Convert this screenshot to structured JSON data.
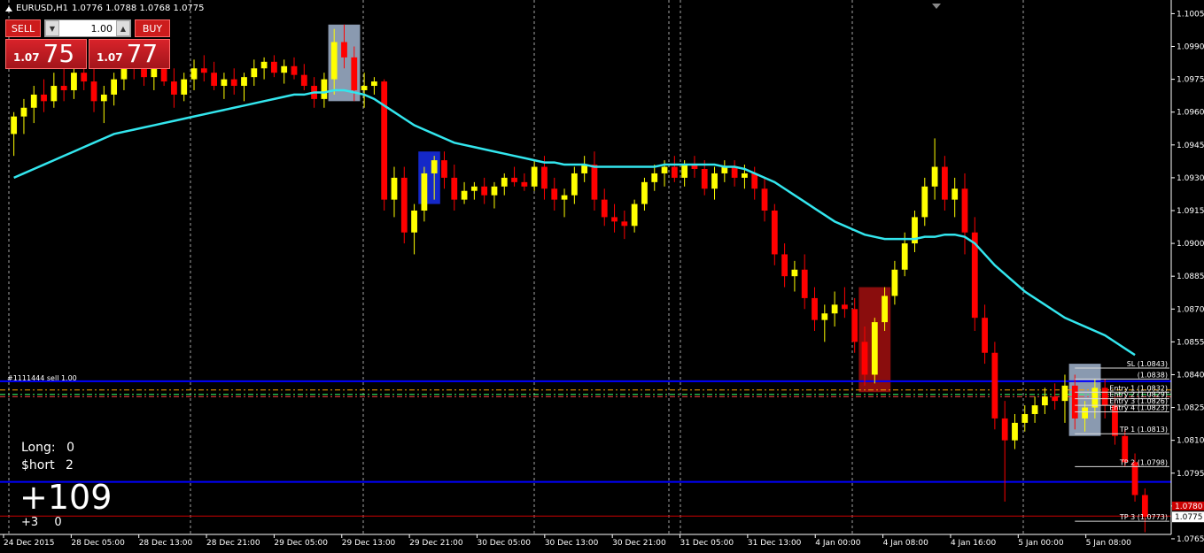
{
  "header": {
    "symbol": "EURUSD,H1",
    "ohlc": "1.0776 1.0788 1.0768 1.0775"
  },
  "trade_panel": {
    "sell_label": "SELL",
    "buy_label": "BUY",
    "lot_value": "1.00",
    "sell_price_prefix": "1.07",
    "sell_price_big": "75",
    "buy_price_prefix": "1.07",
    "buy_price_big": "77"
  },
  "stats": {
    "long_label": "Long:",
    "long_value": "0",
    "short_label": "$hort",
    "short_value": "2",
    "profit": "+109",
    "small_left": "+3",
    "small_right": "0"
  },
  "order_tag": "#1111444 sell 1.00",
  "colors": {
    "bull": "#ffff00",
    "bear": "#ff0000",
    "ma": "#33e6ee",
    "level_blue": "#0000ff",
    "current_price": "#cc0000"
  },
  "chart_data": {
    "type": "candlestick",
    "symbol": "EURUSD",
    "timeframe": "H1",
    "ylim": [
      1.0767,
      1.1008
    ],
    "price_ticks": [
      "1.1005",
      "1.0990",
      "1.0975",
      "1.0960",
      "1.0945",
      "1.0930",
      "1.0915",
      "1.0900",
      "1.0885",
      "1.0870",
      "1.0855",
      "1.0840",
      "1.0825",
      "1.0810",
      "1.0795",
      "1.0780",
      "1.0765"
    ],
    "price_tick_values": [
      1.1005,
      1.099,
      1.0975,
      1.096,
      1.0945,
      1.093,
      1.0915,
      1.09,
      1.0885,
      1.087,
      1.0855,
      1.084,
      1.0825,
      1.081,
      1.0795,
      1.078,
      1.0765
    ],
    "time_labels": [
      "24 Dec 2015",
      "28 Dec 05:00",
      "28 Dec 13:00",
      "28 Dec 21:00",
      "29 Dec 05:00",
      "29 Dec 13:00",
      "29 Dec 21:00",
      "30 Dec 05:00",
      "30 Dec 13:00",
      "30 Dec 21:00",
      "31 Dec 05:00",
      "31 Dec 13:00",
      "4 Jan 00:00",
      "4 Jan 08:00",
      "4 Jan 16:00",
      "5 Jan 00:00",
      "5 Jan 08:00"
    ],
    "current_price": 1.0775,
    "current_price_label": "1.0775",
    "current_price_marker": "1.0780",
    "blue_levels": [
      1.0837,
      1.0791
    ],
    "dashed_levels": [
      1.0833,
      1.0831,
      1.083
    ],
    "trade_levels": [
      {
        "label": "SL (1.0843)",
        "value": 1.0843
      },
      {
        "label": "(1.0838)",
        "value": 1.0838
      },
      {
        "label": "Entry 1 (1.0832)",
        "value": 1.0832
      },
      {
        "label": "Entry 2 (1.0829)",
        "value": 1.0829
      },
      {
        "label": "Entry 3 (1.0826)",
        "value": 1.0826
      },
      {
        "label": "Entry 4 (1.0823)",
        "value": 1.0823
      },
      {
        "label": "TP 1 (1.0813)",
        "value": 1.0813
      },
      {
        "label": "TP 2 (1.0798)",
        "value": 1.0798
      },
      {
        "label": "TP 3 (1.0773)",
        "value": 1.0773
      }
    ],
    "candles": [
      [
        1.095,
        1.096,
        1.094,
        1.0958
      ],
      [
        1.0958,
        1.0966,
        1.095,
        1.0962
      ],
      [
        1.0962,
        1.0972,
        1.0955,
        1.0968
      ],
      [
        1.0968,
        1.0975,
        1.096,
        1.0965
      ],
      [
        1.0965,
        1.0978,
        1.0962,
        1.0972
      ],
      [
        1.0972,
        1.098,
        1.0965,
        1.097
      ],
      [
        1.097,
        1.0982,
        1.0966,
        1.0978
      ],
      [
        1.0978,
        1.0985,
        1.097,
        1.0974
      ],
      [
        1.0974,
        1.098,
        1.096,
        1.0965
      ],
      [
        1.0965,
        1.0972,
        1.0955,
        1.0968
      ],
      [
        1.0968,
        1.0978,
        1.0963,
        1.0975
      ],
      [
        1.0975,
        1.0986,
        1.097,
        1.0982
      ],
      [
        1.0982,
        1.0988,
        1.0975,
        1.098
      ],
      [
        1.098,
        1.0985,
        1.0972,
        1.0976
      ],
      [
        1.0976,
        1.0983,
        1.097,
        1.098
      ],
      [
        1.098,
        1.0986,
        1.0972,
        1.0974
      ],
      [
        1.0974,
        1.098,
        1.0962,
        1.0968
      ],
      [
        1.0968,
        1.0978,
        1.0965,
        1.0975
      ],
      [
        1.0975,
        1.0984,
        1.097,
        1.098
      ],
      [
        1.098,
        1.0986,
        1.0974,
        1.0978
      ],
      [
        1.0978,
        1.0983,
        1.097,
        1.0972
      ],
      [
        1.0972,
        1.0978,
        1.0966,
        1.0975
      ],
      [
        1.0975,
        1.098,
        1.0968,
        1.0972
      ],
      [
        1.0972,
        1.0978,
        1.0965,
        1.0976
      ],
      [
        1.0976,
        1.0984,
        1.0972,
        1.098
      ],
      [
        1.098,
        1.0985,
        1.0975,
        1.0983
      ],
      [
        1.0983,
        1.0986,
        1.0976,
        1.0978
      ],
      [
        1.0978,
        1.0984,
        1.0973,
        1.0981
      ],
      [
        1.0981,
        1.0985,
        1.0975,
        1.0977
      ],
      [
        1.0977,
        1.0982,
        1.097,
        1.0972
      ],
      [
        1.0972,
        1.0976,
        1.0962,
        1.0966
      ],
      [
        1.0966,
        1.0978,
        1.0962,
        1.0975
      ],
      [
        1.0975,
        1.0998,
        1.0968,
        1.0992
      ],
      [
        1.0992,
        1.1,
        1.098,
        1.0985
      ],
      [
        1.0985,
        1.099,
        1.0965,
        1.097
      ],
      [
        1.097,
        1.0978,
        1.0962,
        1.0972
      ],
      [
        1.0972,
        1.0976,
        1.0968,
        1.0974
      ],
      [
        1.0974,
        1.0975,
        1.0915,
        1.092
      ],
      [
        1.092,
        1.0935,
        1.0912,
        1.093
      ],
      [
        1.093,
        1.0935,
        1.09,
        1.0905
      ],
      [
        1.0905,
        1.0918,
        1.0895,
        1.0915
      ],
      [
        1.0915,
        1.0935,
        1.091,
        1.0932
      ],
      [
        1.0932,
        1.094,
        1.092,
        1.0938
      ],
      [
        1.0938,
        1.0942,
        1.0925,
        1.093
      ],
      [
        1.093,
        1.0936,
        1.0915,
        1.092
      ],
      [
        1.092,
        1.0928,
        1.0918,
        1.0924
      ],
      [
        1.0924,
        1.0928,
        1.092,
        1.0926
      ],
      [
        1.0926,
        1.093,
        1.0918,
        1.0922
      ],
      [
        1.0922,
        1.0928,
        1.0916,
        1.0926
      ],
      [
        1.0926,
        1.0932,
        1.0922,
        1.093
      ],
      [
        1.093,
        1.0935,
        1.0926,
        1.0928
      ],
      [
        1.0928,
        1.0932,
        1.0924,
        1.0926
      ],
      [
        1.0926,
        1.0938,
        1.0924,
        1.0935
      ],
      [
        1.0935,
        1.094,
        1.092,
        1.0925
      ],
      [
        1.0925,
        1.093,
        1.0915,
        1.092
      ],
      [
        1.092,
        1.0925,
        1.0912,
        1.0922
      ],
      [
        1.0922,
        1.0935,
        1.0918,
        1.0932
      ],
      [
        1.0932,
        1.094,
        1.0928,
        1.0936
      ],
      [
        1.0936,
        1.0942,
        1.0915,
        1.092
      ],
      [
        1.092,
        1.0925,
        1.0908,
        1.0912
      ],
      [
        1.0912,
        1.0918,
        1.0905,
        1.091
      ],
      [
        1.091,
        1.0915,
        1.0902,
        1.0908
      ],
      [
        1.0908,
        1.092,
        1.0905,
        1.0918
      ],
      [
        1.0918,
        1.093,
        1.0915,
        1.0928
      ],
      [
        1.0928,
        1.0936,
        1.0924,
        1.0932
      ],
      [
        1.0932,
        1.0938,
        1.0926,
        1.0935
      ],
      [
        1.0935,
        1.094,
        1.0928,
        1.093
      ],
      [
        1.093,
        1.0938,
        1.0926,
        1.0936
      ],
      [
        1.0936,
        1.094,
        1.093,
        1.0934
      ],
      [
        1.0934,
        1.0938,
        1.0922,
        1.0925
      ],
      [
        1.0925,
        1.0935,
        1.092,
        1.0932
      ],
      [
        1.0932,
        1.0938,
        1.0928,
        1.0935
      ],
      [
        1.0935,
        1.0938,
        1.0926,
        1.093
      ],
      [
        1.093,
        1.0936,
        1.0925,
        1.0932
      ],
      [
        1.0932,
        1.0935,
        1.092,
        1.0925
      ],
      [
        1.0925,
        1.093,
        1.091,
        1.0915
      ],
      [
        1.0915,
        1.0918,
        1.089,
        1.0895
      ],
      [
        1.0895,
        1.09,
        1.088,
        1.0885
      ],
      [
        1.0885,
        1.0892,
        1.0878,
        1.0888
      ],
      [
        1.0888,
        1.0895,
        1.087,
        1.0875
      ],
      [
        1.0875,
        1.088,
        1.086,
        1.0865
      ],
      [
        1.0865,
        1.0872,
        1.0855,
        1.0868
      ],
      [
        1.0868,
        1.0878,
        1.0862,
        1.0872
      ],
      [
        1.0872,
        1.088,
        1.0866,
        1.087
      ],
      [
        1.087,
        1.0875,
        1.085,
        1.0855
      ],
      [
        1.0855,
        1.0862,
        1.0835,
        1.084
      ],
      [
        1.084,
        1.0866,
        1.0836,
        1.0864
      ],
      [
        1.0864,
        1.088,
        1.086,
        1.0876
      ],
      [
        1.0876,
        1.0892,
        1.0872,
        1.0888
      ],
      [
        1.0888,
        1.0905,
        1.0885,
        1.09
      ],
      [
        1.09,
        1.0915,
        1.0896,
        1.0912
      ],
      [
        1.0912,
        1.093,
        1.0908,
        1.0926
      ],
      [
        1.0926,
        1.0948,
        1.092,
        1.0935
      ],
      [
        1.0935,
        1.094,
        1.0915,
        1.092
      ],
      [
        1.092,
        1.093,
        1.0912,
        1.0925
      ],
      [
        1.0925,
        1.0932,
        1.0895,
        1.0905
      ],
      [
        1.0905,
        1.0912,
        1.086,
        1.0866
      ],
      [
        1.0866,
        1.0872,
        1.0845,
        1.085
      ],
      [
        1.085,
        1.0855,
        1.0815,
        1.082
      ],
      [
        1.082,
        1.0828,
        1.0782,
        1.081
      ],
      [
        1.081,
        1.0822,
        1.0806,
        1.0818
      ],
      [
        1.0818,
        1.0826,
        1.0814,
        1.0822
      ],
      [
        1.0822,
        1.083,
        1.0818,
        1.0826
      ],
      [
        1.0826,
        1.0834,
        1.0822,
        1.083
      ],
      [
        1.083,
        1.0836,
        1.0824,
        1.0828
      ],
      [
        1.0828,
        1.084,
        1.0818,
        1.0835
      ],
      [
        1.0835,
        1.084,
        1.0815,
        1.082
      ],
      [
        1.082,
        1.0828,
        1.0814,
        1.0825
      ],
      [
        1.0825,
        1.0838,
        1.082,
        1.0834
      ],
      [
        1.0834,
        1.0838,
        1.082,
        1.0826
      ],
      [
        1.0826,
        1.083,
        1.0808,
        1.0812
      ],
      [
        1.0812,
        1.0815,
        1.0798,
        1.08
      ],
      [
        1.08,
        1.0804,
        1.0782,
        1.0785
      ],
      [
        1.0785,
        1.0788,
        1.0768,
        1.0775
      ]
    ],
    "ma": [
      1.093,
      1.0932,
      1.0934,
      1.0936,
      1.0938,
      1.094,
      1.0942,
      1.0944,
      1.0946,
      1.0948,
      1.095,
      1.0951,
      1.0952,
      1.0953,
      1.0954,
      1.0955,
      1.0956,
      1.0957,
      1.0958,
      1.0959,
      1.096,
      1.0961,
      1.0962,
      1.0963,
      1.0964,
      1.0965,
      1.0966,
      1.0967,
      1.0968,
      1.0968,
      1.0969,
      1.0969,
      1.097,
      1.097,
      1.0969,
      1.0968,
      1.0966,
      1.0963,
      1.096,
      1.0957,
      1.0954,
      1.0952,
      1.095,
      1.0948,
      1.0946,
      1.0945,
      1.0944,
      1.0943,
      1.0942,
      1.0941,
      1.094,
      1.0939,
      1.0938,
      1.0937,
      1.0937,
      1.0936,
      1.0936,
      1.0936,
      1.0935,
      1.0935,
      1.0935,
      1.0935,
      1.0935,
      1.0935,
      1.0935,
      1.0936,
      1.0936,
      1.0936,
      1.0936,
      1.0936,
      1.0936,
      1.0935,
      1.0935,
      1.0934,
      1.0932,
      1.093,
      1.0928,
      1.0925,
      1.0922,
      1.0919,
      1.0916,
      1.0913,
      1.091,
      1.0908,
      1.0906,
      1.0904,
      1.0903,
      1.0902,
      1.0902,
      1.0902,
      1.0902,
      1.0903,
      1.0903,
      1.0904,
      1.0904,
      1.0903,
      1.09,
      1.0895,
      1.089,
      1.0886,
      1.0882,
      1.0878,
      1.0875,
      1.0872,
      1.0869,
      1.0866,
      1.0864,
      1.0862,
      1.086,
      1.0858,
      1.0855,
      1.0852,
      1.0849
    ]
  }
}
